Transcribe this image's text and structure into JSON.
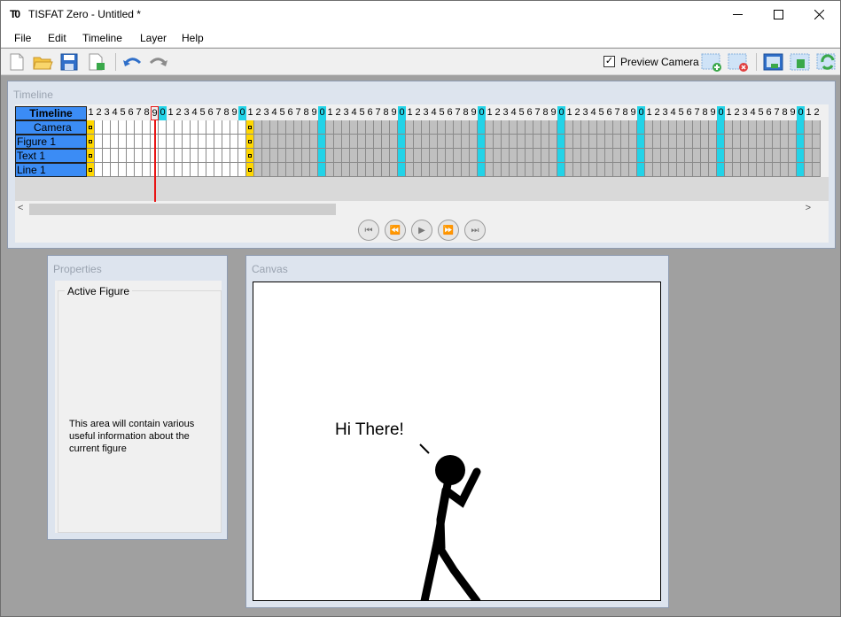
{
  "window": {
    "app_icon_text": "T0",
    "title": "TISFAT Zero - Untitled *",
    "minimize": "—",
    "maximize": "☐",
    "close": "✕"
  },
  "menu": [
    "File",
    "Edit",
    "Timeline",
    "Layer",
    "Help"
  ],
  "toolbar": {
    "preview_camera_label": "Preview Camera",
    "preview_camera_checked": true,
    "check_mark": "✓",
    "buttons": [
      "new-file-icon",
      "open-folder-icon",
      "save-icon",
      "export-icon",
      "undo-icon",
      "redo-icon",
      "add-layer-icon",
      "remove-layer-icon",
      "layer-view-1-icon",
      "layer-view-2-icon",
      "refresh-icon"
    ]
  },
  "timeline": {
    "panel_title": "Timeline",
    "header_label": "Timeline",
    "layers": [
      "Camera",
      "Figure 1",
      "Text 1",
      "Line 1"
    ],
    "frame_digits": [
      "1",
      "2",
      "3",
      "4",
      "5",
      "6",
      "7",
      "8",
      "9",
      "0"
    ],
    "current_frame": 9,
    "scroll_left": "<",
    "scroll_right": ">",
    "playback": [
      "⏮",
      "⏪",
      "▶",
      "⏩",
      "⏭"
    ]
  },
  "properties": {
    "panel_title": "Properties",
    "group_label": "Active Figure",
    "info_text": "This area will contain various useful information about the current figure"
  },
  "canvas": {
    "panel_title": "Canvas",
    "speech_text": "Hi There!"
  },
  "colors": {
    "layer_blue": "#3b8cf5",
    "keyframe_yellow": "#ffd700",
    "tenth_frame_cyan": "#22d3e8",
    "playhead_red": "#e81515"
  }
}
